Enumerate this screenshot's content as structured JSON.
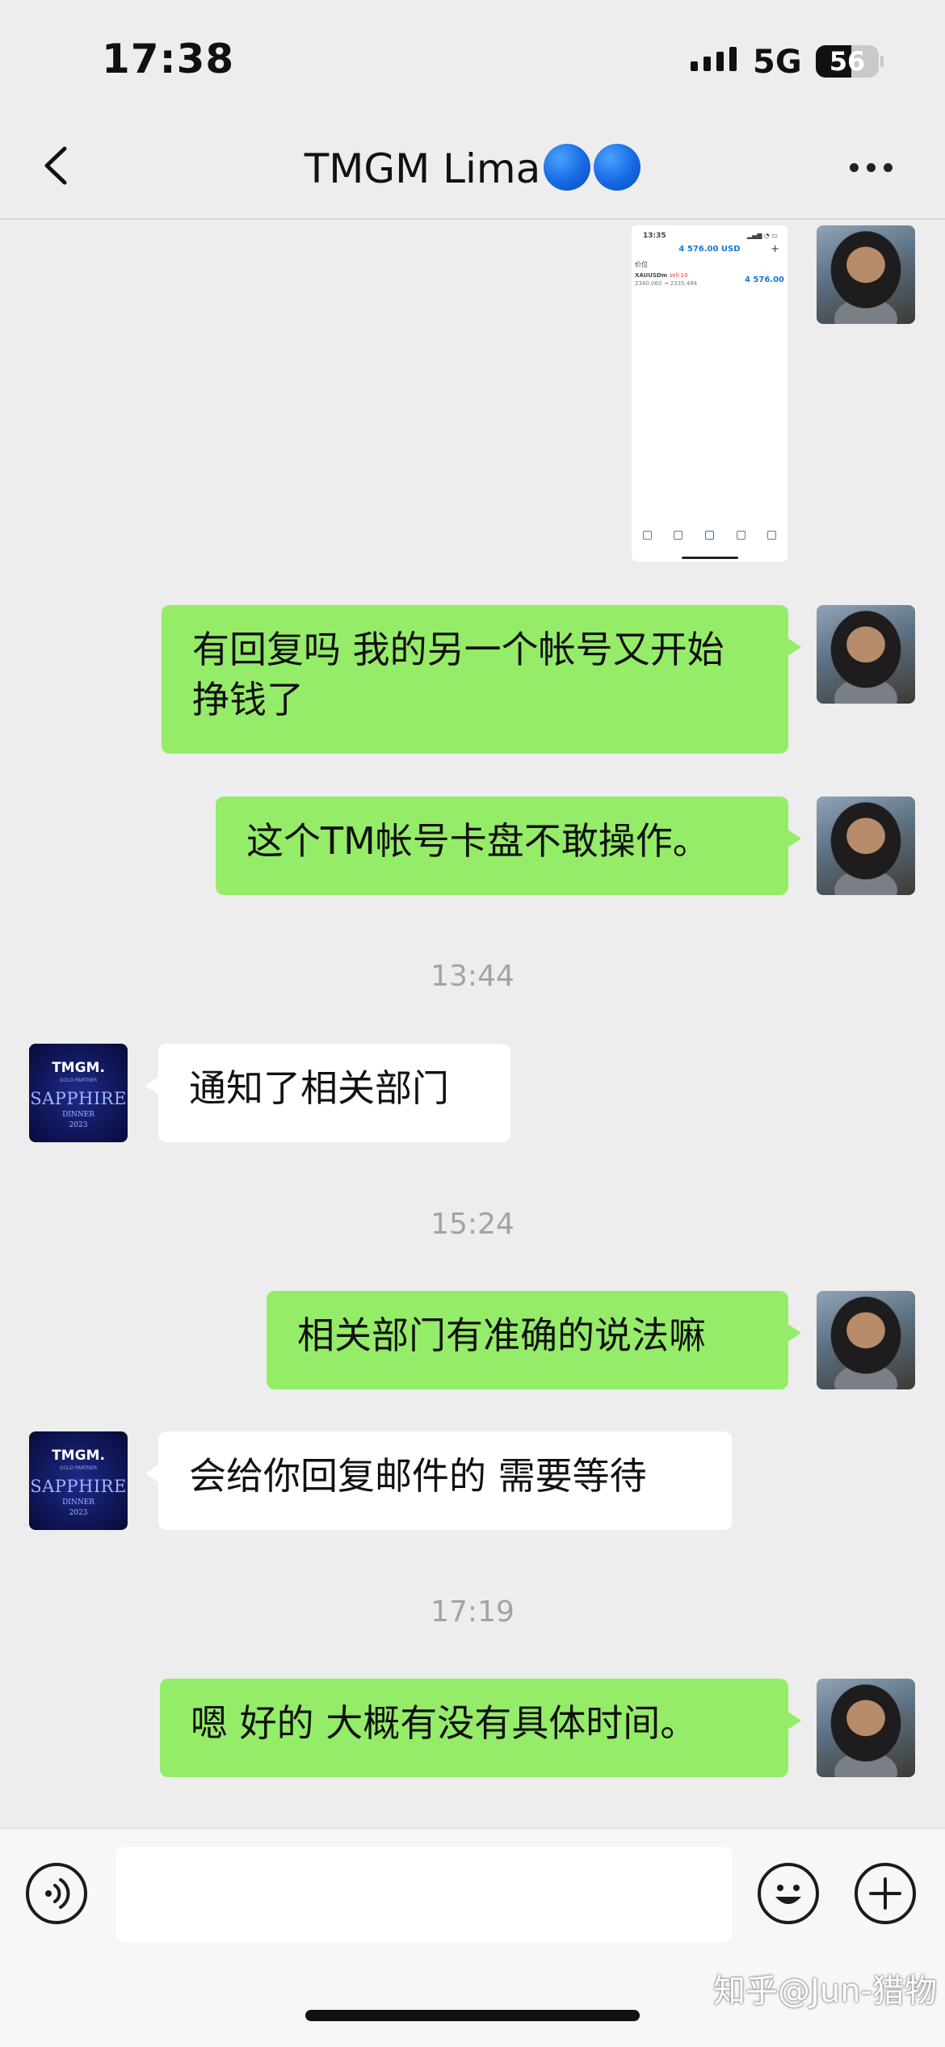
{
  "status_bar": {
    "time": "17:38",
    "network": "5G",
    "battery": "56",
    "battery_level": 0.56
  },
  "header": {
    "title": "TMGM Lima",
    "title_emoji": "🔵🔵"
  },
  "image_message": {
    "time": "13:35",
    "balance": "4 576.00 USD",
    "label": "价位",
    "symbol": "XAUUSDm",
    "side": "sell 10",
    "price": "2340.060 → 2335.484",
    "profit": "4 576.00"
  },
  "messages": [
    {
      "type": "out",
      "text": "有回复吗  我的另一个帐号又开始挣钱了"
    },
    {
      "type": "out",
      "text": "这个TM帐号卡盘不敢操作。"
    },
    {
      "type": "time",
      "text": "13:44"
    },
    {
      "type": "in",
      "text": "通知了相关部门"
    },
    {
      "type": "time",
      "text": "15:24"
    },
    {
      "type": "out",
      "text": "相关部门有准确的说法嘛"
    },
    {
      "type": "in",
      "text": "会给你回复邮件的 需要等待"
    },
    {
      "type": "time",
      "text": "17:19"
    },
    {
      "type": "out",
      "text": "嗯  好的  大概有没有具体时间。"
    }
  ],
  "agent_avatar": {
    "brand": "TMGM.",
    "sub": "GOLD PARTNER",
    "main": "SAPPHIRE",
    "line1": "DINNER",
    "line2": "2023"
  },
  "input": {
    "value": "",
    "placeholder": ""
  },
  "watermark": "知乎@Jun-猎物"
}
